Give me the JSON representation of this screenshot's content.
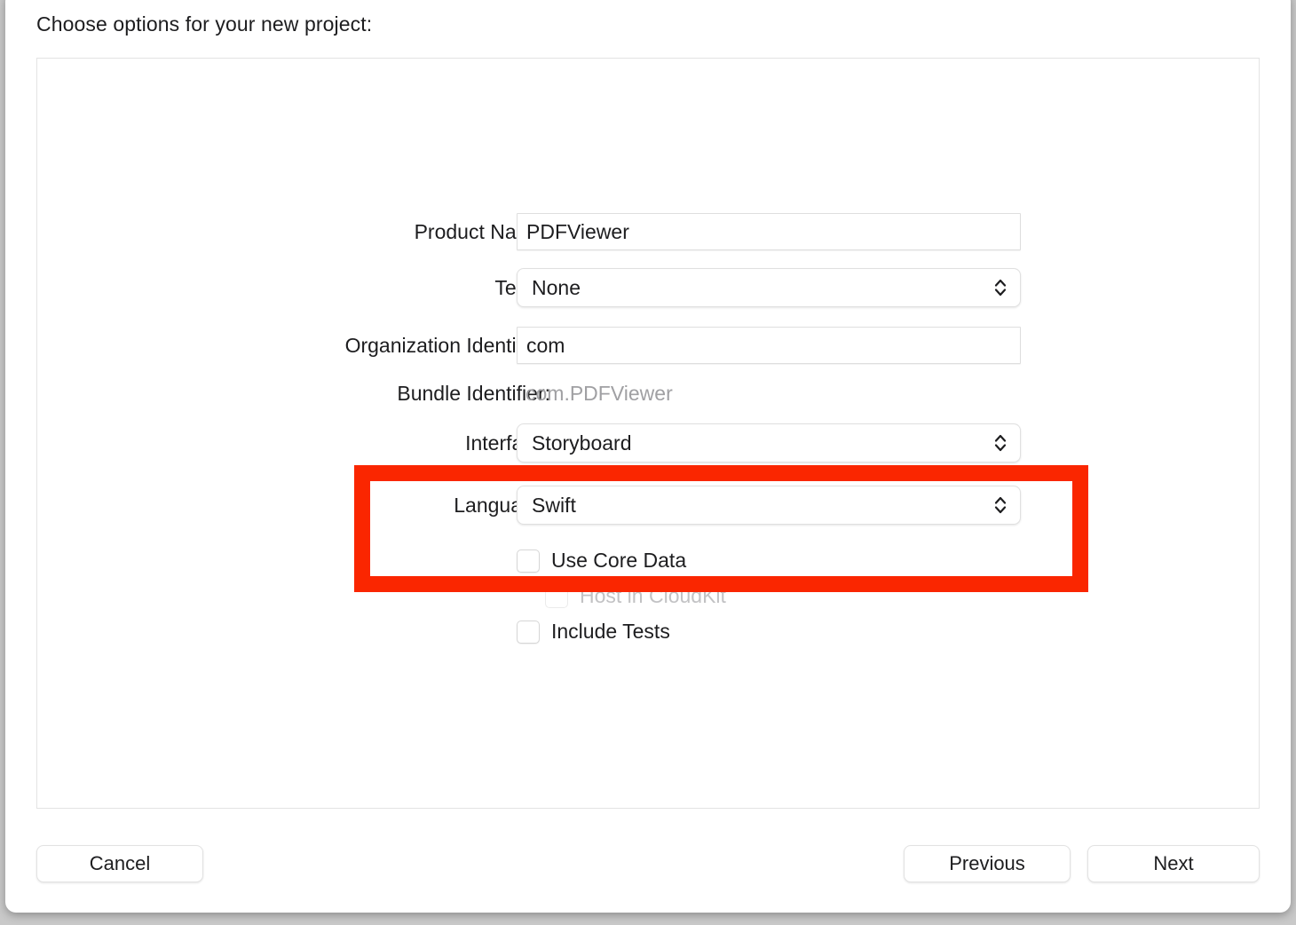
{
  "window": {
    "title": "Choose options for your new project:"
  },
  "form": {
    "rows": [
      {
        "label": "Product Name:",
        "type": "text",
        "value": "PDFViewer",
        "placeholder": "Product Name"
      },
      {
        "label": "Team:",
        "type": "popup",
        "value": "None"
      },
      {
        "label": "Organization Identifier:",
        "type": "text",
        "value": "com",
        "placeholder": "Organization Identifier"
      },
      {
        "label": "Bundle Identifier:",
        "type": "static",
        "value": "com.PDFViewer"
      },
      {
        "label": "Interface:",
        "type": "popup",
        "value": "Storyboard"
      },
      {
        "label": "Language:",
        "type": "popup",
        "value": "Swift"
      }
    ],
    "checkboxes": [
      {
        "label": "Use Core Data",
        "checked": false,
        "disabled": false
      },
      {
        "label": "Host in CloudKit",
        "checked": false,
        "disabled": true
      },
      {
        "label": "Include Tests",
        "checked": false,
        "disabled": false
      }
    ]
  },
  "footer": {
    "cancel_label": "Cancel",
    "previous_label": "Previous",
    "next_label": "Next"
  },
  "annotation": {
    "color": "#fa2600",
    "target": "language-row"
  },
  "icons": {
    "stepper": "chevron-up-down-icon"
  }
}
